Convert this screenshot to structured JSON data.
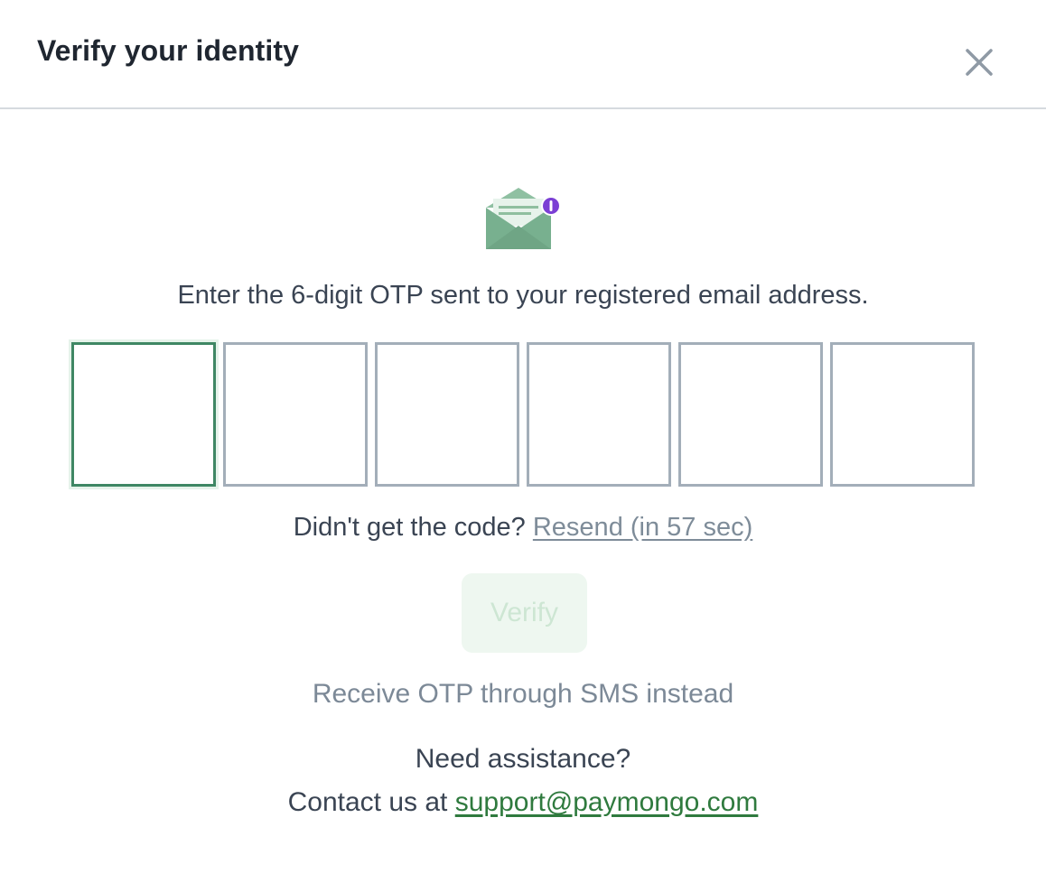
{
  "dialog": {
    "title": "Verify your identity",
    "close_icon": "close-icon"
  },
  "hero": {
    "icon": "envelope-notification-icon",
    "colors": {
      "envelope": "#7fb393",
      "badge": "#7b3fd4"
    }
  },
  "otp": {
    "instruction": "Enter the 6-digit OTP sent to your registered email address.",
    "digit_count": 6,
    "values": [
      "",
      "",
      "",
      "",
      "",
      ""
    ],
    "active_index": 0,
    "colors": {
      "active_border": "#3f8764",
      "border": "#a3aeb9"
    }
  },
  "resend": {
    "prompt": "Didn't get the code?",
    "link_label": "Resend (in 57 sec)"
  },
  "verify_button": {
    "label": "Verify",
    "disabled": true
  },
  "sms_option": {
    "label": "Receive OTP through SMS instead"
  },
  "support": {
    "heading": "Need assistance?",
    "contact_prefix": "Contact us at",
    "email": "support@paymongo.com",
    "link_color": "#2f7a3e"
  }
}
